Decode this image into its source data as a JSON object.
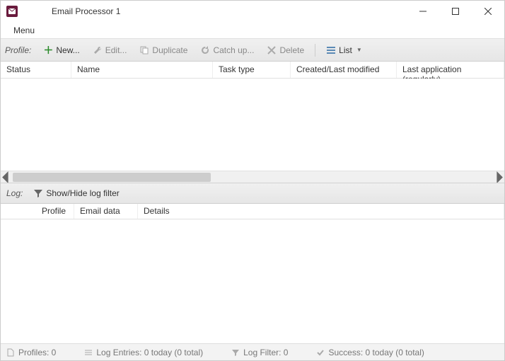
{
  "window": {
    "title": "Email Processor 1"
  },
  "menubar": {
    "menu": "Menu"
  },
  "toolbar": {
    "label": "Profile:",
    "new": "New...",
    "edit": "Edit...",
    "duplicate": "Duplicate",
    "catchup": "Catch up...",
    "delete": "Delete",
    "list": "List"
  },
  "grid": {
    "cols": {
      "status": "Status",
      "name": "Name",
      "tasktype": "Task type",
      "created": "Created/Last modified",
      "lastapp": "Last application (regularly)"
    }
  },
  "logbar": {
    "label": "Log:",
    "toggle": "Show/Hide log filter"
  },
  "loggrid": {
    "cols": {
      "profile": "Profile",
      "emaildata": "Email data",
      "details": "Details"
    }
  },
  "status": {
    "profiles": "Profiles: 0",
    "logentries": "Log Entries: 0 today (0 total)",
    "logfilter": "Log Filter: 0",
    "success": "Success: 0 today (0 total)"
  }
}
